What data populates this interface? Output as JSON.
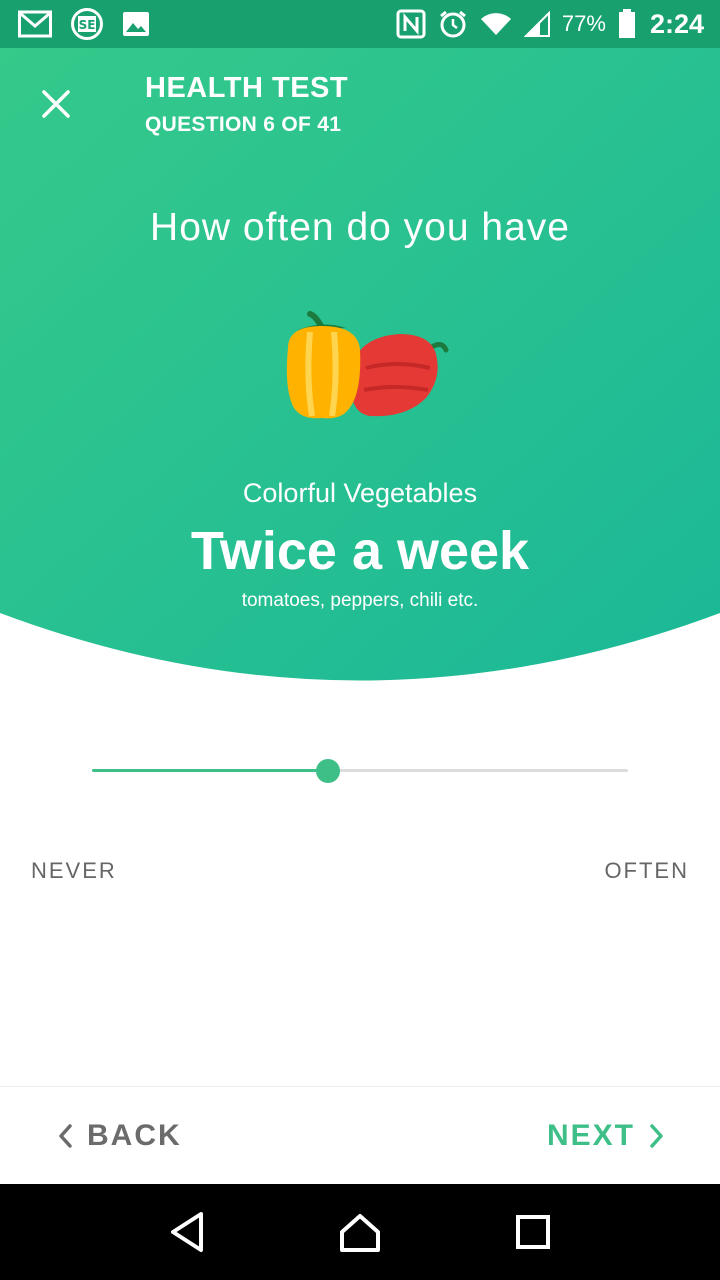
{
  "status_bar": {
    "battery_percent": "77%",
    "time": "2:24",
    "icons": [
      "gmail-icon",
      "se-app-icon",
      "image-icon",
      "nfc-icon",
      "alarm-icon",
      "wifi-icon",
      "signal-icon",
      "battery-icon"
    ]
  },
  "header": {
    "title": "HEALTH TEST",
    "subtitle": "QUESTION 6 OF 41"
  },
  "question": {
    "prompt": "How often do you have",
    "category": "Colorful Vegetables",
    "answer": "Twice a week",
    "examples": "tomatoes, peppers, chili etc."
  },
  "slider": {
    "value_fraction": 0.44,
    "min_label": "NEVER",
    "max_label": "OFTEN"
  },
  "footer": {
    "back_label": "BACK",
    "next_label": "NEXT"
  },
  "colors": {
    "hero_start": "#35c98a",
    "hero_end": "#1bb898",
    "accent": "#3dbf87",
    "status_bar": "#18a16f"
  }
}
